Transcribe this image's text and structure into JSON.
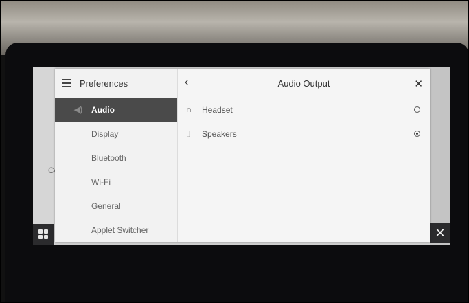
{
  "background": {
    "partial_label": "Co"
  },
  "preferences": {
    "title": "Preferences",
    "items": [
      {
        "label": "Audio",
        "active": true
      },
      {
        "label": "Display",
        "active": false
      },
      {
        "label": "Bluetooth",
        "active": false
      },
      {
        "label": "Wi-Fi",
        "active": false
      },
      {
        "label": "General",
        "active": false
      },
      {
        "label": "Applet Switcher",
        "active": false
      }
    ]
  },
  "audio_output": {
    "title": "Audio Output",
    "back_icon": "chevron-left-icon",
    "close_icon": "close-icon",
    "options": [
      {
        "label": "Headset",
        "icon": "headphones-icon",
        "selected": false
      },
      {
        "label": "Speakers",
        "icon": "speaker-icon",
        "selected": true
      }
    ]
  },
  "taskbar": {
    "app_grid_icon": "app-grid-icon",
    "close_icon": "close-icon"
  }
}
